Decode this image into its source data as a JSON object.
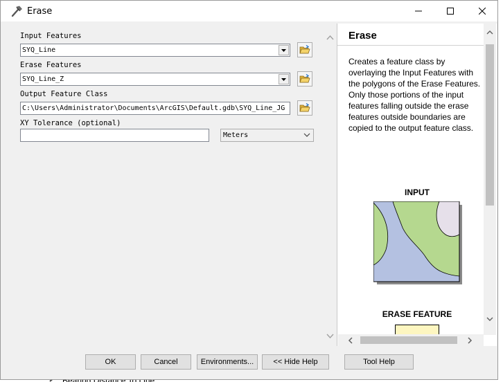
{
  "window": {
    "title": "Erase",
    "app_icon": "hammer-icon"
  },
  "form": {
    "input_features": {
      "label": "Input Features",
      "value": "SYQ_Line",
      "status_icon": "error-icon"
    },
    "erase_features": {
      "label": "Erase Features",
      "value": "SYQ_Line_Z"
    },
    "output_feature_class": {
      "label": "Output Feature Class",
      "value": "C:\\Users\\Administrator\\Documents\\ArcGIS\\Default.gdb\\SYQ_Line_JG"
    },
    "xy_tolerance": {
      "label": "XY Tolerance (optional)",
      "value": "",
      "units": "Meters"
    }
  },
  "help": {
    "title": "Erase",
    "description": "Creates a feature class by overlaying the Input Features with the polygons of the Erase Features. Only those portions of the input features falling outside the erase features outside boundaries are copied to the output feature class.",
    "diagram_input_label": "INPUT",
    "diagram_erase_label": "ERASE FEATURE"
  },
  "buttons": {
    "ok": "OK",
    "cancel": "Cancel",
    "environments": "Environments...",
    "hide_help": "<< Hide Help",
    "tool_help": "Tool Help"
  },
  "background": {
    "partial_text": "Bearing Distance To Line"
  },
  "colors": {
    "error": "#e81123",
    "diagram_green": "#b5d88f",
    "diagram_blue": "#b4c1e1",
    "diagram_lavender": "#e6e0ea",
    "diagram_yellow": "#fdf6c0"
  }
}
